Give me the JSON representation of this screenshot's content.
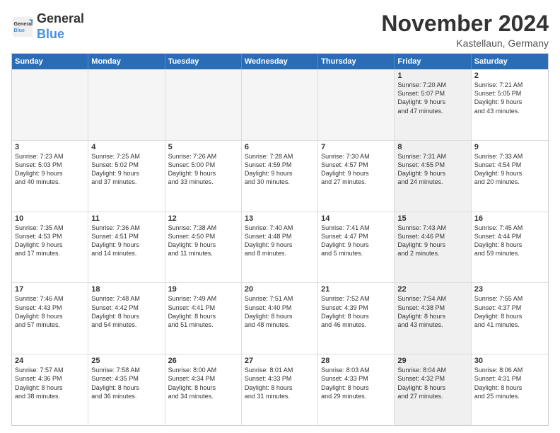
{
  "logo": {
    "line1": "General",
    "line2": "Blue"
  },
  "header": {
    "month": "November 2024",
    "location": "Kastellaun, Germany"
  },
  "weekdays": [
    "Sunday",
    "Monday",
    "Tuesday",
    "Wednesday",
    "Thursday",
    "Friday",
    "Saturday"
  ],
  "rows": [
    [
      {
        "day": "",
        "info": "",
        "empty": true
      },
      {
        "day": "",
        "info": "",
        "empty": true
      },
      {
        "day": "",
        "info": "",
        "empty": true
      },
      {
        "day": "",
        "info": "",
        "empty": true
      },
      {
        "day": "",
        "info": "",
        "empty": true
      },
      {
        "day": "1",
        "info": "Sunrise: 7:20 AM\nSunset: 5:07 PM\nDaylight: 9 hours\nand 47 minutes.",
        "shaded": true
      },
      {
        "day": "2",
        "info": "Sunrise: 7:21 AM\nSunset: 5:05 PM\nDaylight: 9 hours\nand 43 minutes.",
        "shaded": false
      }
    ],
    [
      {
        "day": "3",
        "info": "Sunrise: 7:23 AM\nSunset: 5:03 PM\nDaylight: 9 hours\nand 40 minutes.",
        "shaded": false
      },
      {
        "day": "4",
        "info": "Sunrise: 7:25 AM\nSunset: 5:02 PM\nDaylight: 9 hours\nand 37 minutes.",
        "shaded": false
      },
      {
        "day": "5",
        "info": "Sunrise: 7:26 AM\nSunset: 5:00 PM\nDaylight: 9 hours\nand 33 minutes.",
        "shaded": false
      },
      {
        "day": "6",
        "info": "Sunrise: 7:28 AM\nSunset: 4:59 PM\nDaylight: 9 hours\nand 30 minutes.",
        "shaded": false
      },
      {
        "day": "7",
        "info": "Sunrise: 7:30 AM\nSunset: 4:57 PM\nDaylight: 9 hours\nand 27 minutes.",
        "shaded": false
      },
      {
        "day": "8",
        "info": "Sunrise: 7:31 AM\nSunset: 4:55 PM\nDaylight: 9 hours\nand 24 minutes.",
        "shaded": true
      },
      {
        "day": "9",
        "info": "Sunrise: 7:33 AM\nSunset: 4:54 PM\nDaylight: 9 hours\nand 20 minutes.",
        "shaded": false
      }
    ],
    [
      {
        "day": "10",
        "info": "Sunrise: 7:35 AM\nSunset: 4:53 PM\nDaylight: 9 hours\nand 17 minutes.",
        "shaded": false
      },
      {
        "day": "11",
        "info": "Sunrise: 7:36 AM\nSunset: 4:51 PM\nDaylight: 9 hours\nand 14 minutes.",
        "shaded": false
      },
      {
        "day": "12",
        "info": "Sunrise: 7:38 AM\nSunset: 4:50 PM\nDaylight: 9 hours\nand 11 minutes.",
        "shaded": false
      },
      {
        "day": "13",
        "info": "Sunrise: 7:40 AM\nSunset: 4:48 PM\nDaylight: 9 hours\nand 8 minutes.",
        "shaded": false
      },
      {
        "day": "14",
        "info": "Sunrise: 7:41 AM\nSunset: 4:47 PM\nDaylight: 9 hours\nand 5 minutes.",
        "shaded": false
      },
      {
        "day": "15",
        "info": "Sunrise: 7:43 AM\nSunset: 4:46 PM\nDaylight: 9 hours\nand 2 minutes.",
        "shaded": true
      },
      {
        "day": "16",
        "info": "Sunrise: 7:45 AM\nSunset: 4:44 PM\nDaylight: 8 hours\nand 59 minutes.",
        "shaded": false
      }
    ],
    [
      {
        "day": "17",
        "info": "Sunrise: 7:46 AM\nSunset: 4:43 PM\nDaylight: 8 hours\nand 57 minutes.",
        "shaded": false
      },
      {
        "day": "18",
        "info": "Sunrise: 7:48 AM\nSunset: 4:42 PM\nDaylight: 8 hours\nand 54 minutes.",
        "shaded": false
      },
      {
        "day": "19",
        "info": "Sunrise: 7:49 AM\nSunset: 4:41 PM\nDaylight: 8 hours\nand 51 minutes.",
        "shaded": false
      },
      {
        "day": "20",
        "info": "Sunrise: 7:51 AM\nSunset: 4:40 PM\nDaylight: 8 hours\nand 48 minutes.",
        "shaded": false
      },
      {
        "day": "21",
        "info": "Sunrise: 7:52 AM\nSunset: 4:39 PM\nDaylight: 8 hours\nand 46 minutes.",
        "shaded": false
      },
      {
        "day": "22",
        "info": "Sunrise: 7:54 AM\nSunset: 4:38 PM\nDaylight: 8 hours\nand 43 minutes.",
        "shaded": true
      },
      {
        "day": "23",
        "info": "Sunrise: 7:55 AM\nSunset: 4:37 PM\nDaylight: 8 hours\nand 41 minutes.",
        "shaded": false
      }
    ],
    [
      {
        "day": "24",
        "info": "Sunrise: 7:57 AM\nSunset: 4:36 PM\nDaylight: 8 hours\nand 38 minutes.",
        "shaded": false
      },
      {
        "day": "25",
        "info": "Sunrise: 7:58 AM\nSunset: 4:35 PM\nDaylight: 8 hours\nand 36 minutes.",
        "shaded": false
      },
      {
        "day": "26",
        "info": "Sunrise: 8:00 AM\nSunset: 4:34 PM\nDaylight: 8 hours\nand 34 minutes.",
        "shaded": false
      },
      {
        "day": "27",
        "info": "Sunrise: 8:01 AM\nSunset: 4:33 PM\nDaylight: 8 hours\nand 31 minutes.",
        "shaded": false
      },
      {
        "day": "28",
        "info": "Sunrise: 8:03 AM\nSunset: 4:33 PM\nDaylight: 8 hours\nand 29 minutes.",
        "shaded": false
      },
      {
        "day": "29",
        "info": "Sunrise: 8:04 AM\nSunset: 4:32 PM\nDaylight: 8 hours\nand 27 minutes.",
        "shaded": true
      },
      {
        "day": "30",
        "info": "Sunrise: 8:06 AM\nSunset: 4:31 PM\nDaylight: 8 hours\nand 25 minutes.",
        "shaded": false
      }
    ]
  ]
}
